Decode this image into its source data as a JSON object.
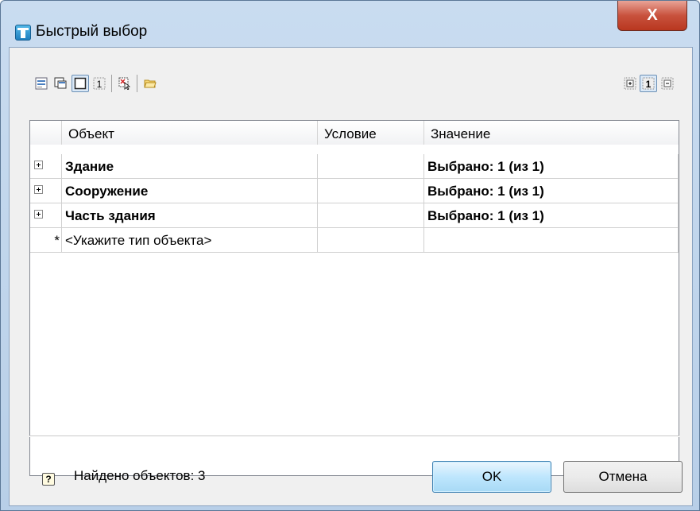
{
  "window": {
    "title": "Быстрый выбор",
    "close_label": "X"
  },
  "toolbar": {
    "left_icons": [
      "select-properties-icon",
      "select-window-icon",
      "select-frame-icon",
      "select-single-icon",
      "clear-selection-icon",
      "open-folder-icon"
    ],
    "right_icons": [
      "expand-all-icon",
      "show-one-icon",
      "collapse-all-icon"
    ],
    "right_single_label": "1"
  },
  "grid": {
    "columns": [
      "Объект",
      "Условие",
      "Значение"
    ],
    "rows": [
      {
        "object": "Здание",
        "condition": "",
        "value": "Выбрано: 1 (из 1)",
        "bold": true,
        "expandable": true
      },
      {
        "object": "Сооружение",
        "condition": "",
        "value": "Выбрано: 1 (из 1)",
        "bold": true,
        "expandable": true
      },
      {
        "object": "Часть здания",
        "condition": "",
        "value": "Выбрано: 1 (из 1)",
        "bold": true,
        "expandable": true
      },
      {
        "object": "<Укажите тип объекта>",
        "condition": "",
        "value": "",
        "bold": false,
        "expandable": false,
        "marker": "*"
      }
    ]
  },
  "footer": {
    "found_text": "Найдено объектов: 3",
    "ok_label": "OK",
    "cancel_label": "Отмена"
  }
}
